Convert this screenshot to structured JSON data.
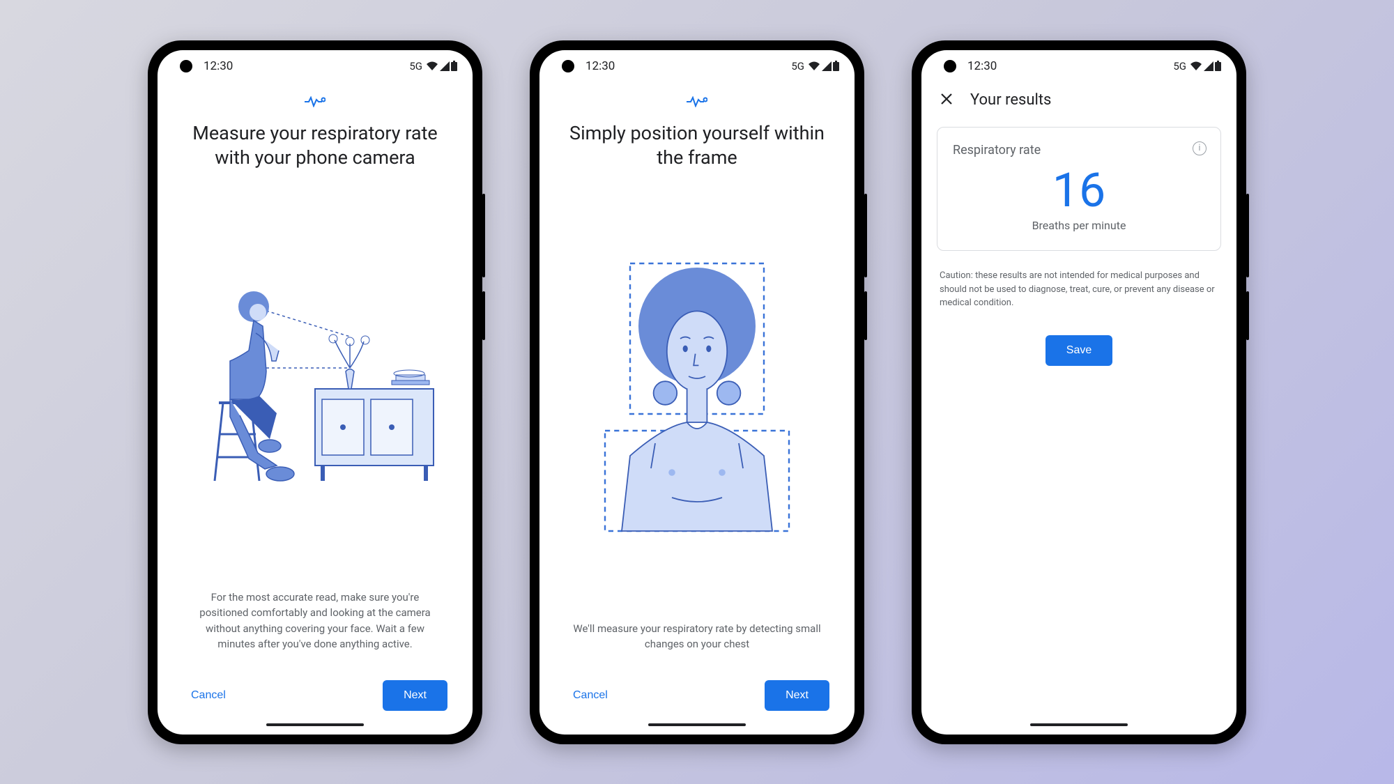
{
  "status": {
    "time": "12:30",
    "network": "5G"
  },
  "screens": [
    {
      "heading": "Measure your respiratory rate with your phone camera",
      "description": "For the most accurate read, make sure you're positioned comfortably and looking at the camera without anything covering your face. Wait a few minutes after you've done anything active.",
      "cancel_label": "Cancel",
      "next_label": "Next"
    },
    {
      "heading": "Simply position yourself within the frame",
      "description": "We'll measure your respiratory rate by detecting small changes on your chest",
      "cancel_label": "Cancel",
      "next_label": "Next"
    },
    {
      "header_title": "Your results",
      "card_title": "Respiratory rate",
      "value": "16",
      "unit": "Breaths per minute",
      "caution": "Caution: these results are not intended for medical purposes and should not be used to diagnose, treat, cure, or prevent any disease or medical condition.",
      "save_label": "Save"
    }
  ]
}
